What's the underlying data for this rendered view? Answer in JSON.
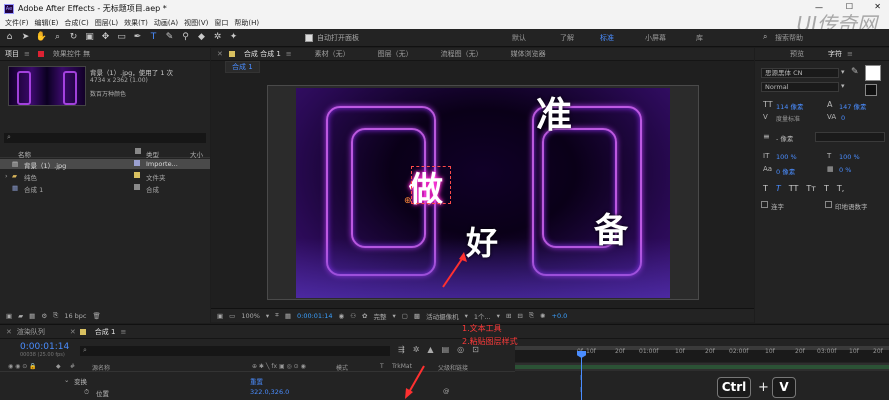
{
  "window": {
    "title": "Adobe After Effects - 无标题项目.aep *"
  },
  "menu": [
    "文件(F)",
    "编辑(E)",
    "合成(C)",
    "图层(L)",
    "效果(T)",
    "动画(A)",
    "视图(V)",
    "窗口",
    "帮助(H)"
  ],
  "toolbar": {
    "auto_open_panels": "自动打开面板",
    "workspaces": [
      "默认",
      "了解",
      "标准",
      "小屏幕",
      "库"
    ],
    "active_workspace": "标准",
    "search_help": "搜索帮助"
  },
  "watermark": "UI传奇网",
  "project_panel": {
    "tab_project": "项目",
    "tab_effects": "效果控件 無",
    "item_name": "背景（1）.jpg",
    "item_used": "，使用了 1 次",
    "item_dims": "4734 x 2362 (1.00)",
    "item_colors": "数百万种颜色",
    "col_name": "名称",
    "col_type": "类型",
    "col_size": "大小",
    "files": [
      {
        "name": "背景（1）.jpg",
        "type": "Importe..."
      },
      {
        "name": "纯色",
        "type": "文件夹"
      },
      {
        "name": "合成 1",
        "type": "合成"
      }
    ],
    "bpc": "16 bpc"
  },
  "comp_panel": {
    "tab_comp": "合成 合成 1",
    "tab_material": "素材（无）",
    "tab_layer": "图层（无）",
    "tab_flow": "流程图（无）",
    "tab_media": "媒体浏览器",
    "crumb": "合成 1",
    "canvas_text": [
      "准",
      "做",
      "好",
      "备"
    ],
    "zoom": "100%",
    "timecode": "0:00:01:14",
    "resolution": "完整",
    "camera": "活动摄像机",
    "views": "1个...",
    "exposure": "+0.0"
  },
  "right_panel": {
    "tab_preview": "预览",
    "tab_char": "字符",
    "font": "思源黑体 CN",
    "style": "Normal",
    "size": "114 像素",
    "leading": "147 像素",
    "kerning": "度量标准",
    "tracking": "0",
    "stroke": "- 像素",
    "vscale": "100 %",
    "hscale": "100 %",
    "baseline": "0 像素",
    "tsume": "0 %",
    "style_buttons": [
      "T",
      "T",
      "TT",
      "Tт",
      "T",
      "T,"
    ],
    "ligature": "连字",
    "hindi": "印地语数字"
  },
  "timeline": {
    "tab_render": "渲染队列",
    "tab_comp": "合成 1",
    "timecode": "0:00:01:14",
    "frames": "00038 (25.00 fps)",
    "col_source": "源名称",
    "col_mode": "模式",
    "col_trkmat": "TrkMat",
    "col_parent": "父级和链接",
    "transform": "变换",
    "reset": "重置",
    "position_label": "位置",
    "position_value": "322.0,326.0",
    "ruler": [
      "0f",
      "10f",
      "20f",
      "01:00f",
      "10f",
      "20f",
      "02:00f",
      "10f",
      "20f",
      "03:00f",
      "10f",
      "20f"
    ],
    "notes": [
      "1.文本工具",
      "2.粘贴图层样式"
    ],
    "shortcut_ctrl": "Ctrl",
    "shortcut_plus": "+",
    "shortcut_v": "V"
  }
}
